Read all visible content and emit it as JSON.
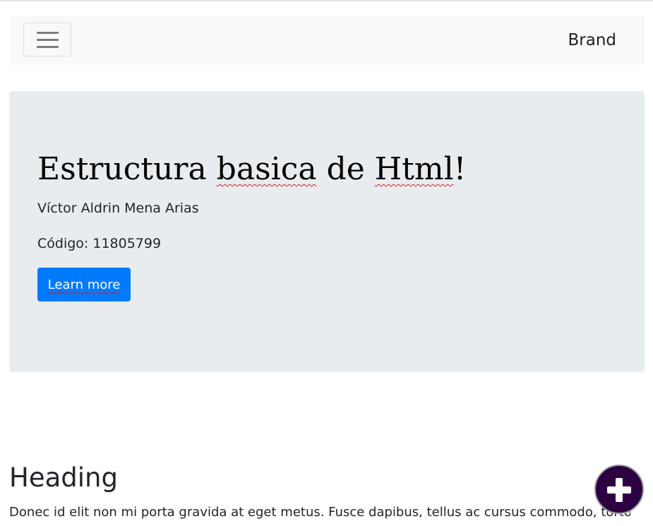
{
  "navbar": {
    "toggler_icon": "hamburger-menu-icon",
    "brand": "Brand"
  },
  "jumbotron": {
    "title_parts": [
      "Estructura ",
      "basica",
      " de ",
      "Html",
      "!"
    ],
    "author": "Víctor Aldrin Mena Arias",
    "code": "Código: 11805799",
    "button_label": "Learn more",
    "background": "#e9ecef"
  },
  "section": {
    "heading": "Heading",
    "text": "Donec id elit non mi porta gravida at eget metus. Fusce dapibus, tellus ac cursus commodo, tortor"
  },
  "fab": {
    "icon": "plus-icon"
  },
  "colors": {
    "primary": "#007bff",
    "fab": "#2d0042",
    "navbar": "#f8f9fa"
  }
}
